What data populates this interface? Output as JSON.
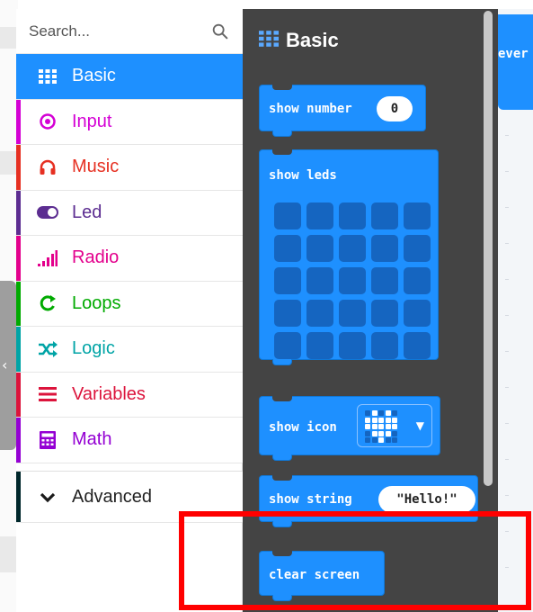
{
  "search": {
    "placeholder": "Search..."
  },
  "categories": [
    {
      "label": "Basic",
      "color": "#1e90ff",
      "icon": "grid-icon",
      "active": true
    },
    {
      "label": "Input",
      "color": "#d400d4",
      "icon": "target-icon"
    },
    {
      "label": "Music",
      "color": "#e63022",
      "icon": "headphones-icon"
    },
    {
      "label": "Led",
      "color": "#5c2d91",
      "icon": "toggle-icon"
    },
    {
      "label": "Radio",
      "color": "#e3008c",
      "icon": "signal-icon"
    },
    {
      "label": "Loops",
      "color": "#00aa00",
      "icon": "refresh-icon"
    },
    {
      "label": "Logic",
      "color": "#00a4a6",
      "icon": "shuffle-icon"
    },
    {
      "label": "Variables",
      "color": "#dc143c",
      "icon": "menu-icon"
    },
    {
      "label": "Math",
      "color": "#9400d3",
      "icon": "calculator-icon"
    }
  ],
  "advanced": {
    "label": "Advanced",
    "color": "#00272b",
    "icon": "chevron-down-icon"
  },
  "flyout": {
    "title": "Basic",
    "blocks": {
      "show_number": {
        "label": "show number",
        "value": "0"
      },
      "show_leds": {
        "label": "show leds"
      },
      "show_icon": {
        "label": "show icon"
      },
      "show_string": {
        "label": "show string",
        "value": "\"Hello!\""
      },
      "clear_screen": {
        "label": "clear screen"
      }
    }
  },
  "workspace": {
    "block_label": "ever"
  },
  "colors": {
    "block_blue": "#1e90ff",
    "flyout_bg": "#444444",
    "highlight": "#ff0000"
  }
}
